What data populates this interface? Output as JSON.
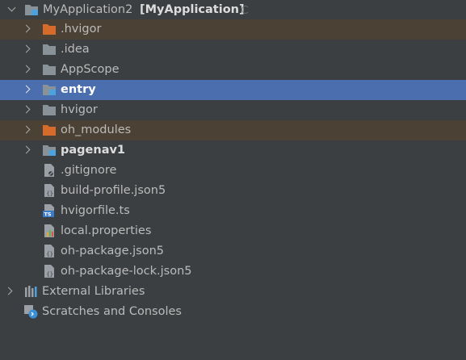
{
  "root": {
    "name": "MyApplication2",
    "module": "[MyApplication]"
  },
  "items": [
    {
      "label": "MyApplication2"
    },
    {
      "label": ".hvigor"
    },
    {
      "label": ".idea"
    },
    {
      "label": "AppScope"
    },
    {
      "label": "entry"
    },
    {
      "label": "hvigor"
    },
    {
      "label": "oh_modules"
    },
    {
      "label": "pagenav1"
    },
    {
      "label": ".gitignore"
    },
    {
      "label": "build-profile.json5"
    },
    {
      "label": "hvigorfile.ts"
    },
    {
      "label": "local.properties"
    },
    {
      "label": "oh-package.json5"
    },
    {
      "label": "oh-package-lock.json5"
    },
    {
      "label": "External Libraries"
    },
    {
      "label": "Scratches and Consoles"
    }
  ],
  "icons": {
    "folder": "folder-icon",
    "module_folder": "module-folder-icon",
    "excluded_folder": "excluded-folder-icon",
    "file": "file-icon",
    "ts": "typescript-file-icon",
    "properties": "properties-file-icon",
    "libraries": "external-libraries-icon",
    "scratches": "scratches-icon"
  },
  "colors": {
    "background": "#3c3f41",
    "selection": "#4b6eaf",
    "excluded_row": "#4c4135",
    "folder": "#8a9299",
    "excluded_folder": "#d66b2b",
    "module_marker": "#4aa3e0",
    "text": "#bbbbbb"
  }
}
